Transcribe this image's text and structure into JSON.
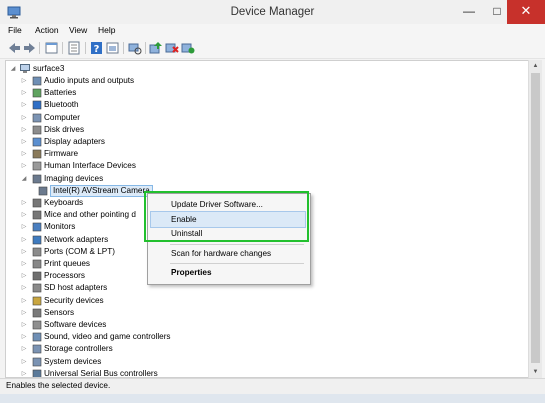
{
  "window": {
    "title": "Device Manager"
  },
  "title_buttons": {
    "minimize": "—",
    "maximize": "□",
    "close": "✕"
  },
  "menu": [
    "File",
    "Action",
    "View",
    "Help"
  ],
  "toolbar_icons": [
    "back-icon",
    "forward-icon",
    "properties-icon",
    "show-hidden-icon",
    "help-icon",
    "console-icon",
    "update-driver-icon",
    "disable-icon",
    "uninstall-icon",
    "scan-icon"
  ],
  "tree": {
    "root": "surface3",
    "categories": [
      "Audio inputs and outputs",
      "Batteries",
      "Bluetooth",
      "Computer",
      "Disk drives",
      "Display adapters",
      "Firmware",
      "Human Interface Devices",
      "Imaging devices",
      "Intel(R) AVStream Camera",
      "Keyboards",
      "Mice and other pointing d",
      "Monitors",
      "Network adapters",
      "Ports (COM & LPT)",
      "Print queues",
      "Processors",
      "SD host adapters",
      "Security devices",
      "Sensors",
      "Software devices",
      "Sound, video and game controllers",
      "Storage controllers",
      "System devices",
      "Universal Serial Bus controllers"
    ]
  },
  "context_menu": {
    "update": "Update Driver Software...",
    "enable": "Enable",
    "uninstall": "Uninstall",
    "scan": "Scan for hardware changes",
    "properties": "Properties"
  },
  "status": "Enables the selected device.",
  "colors": {
    "highlight": "#22c02e",
    "close": "#c7312b",
    "selection": "#dceaf8"
  }
}
